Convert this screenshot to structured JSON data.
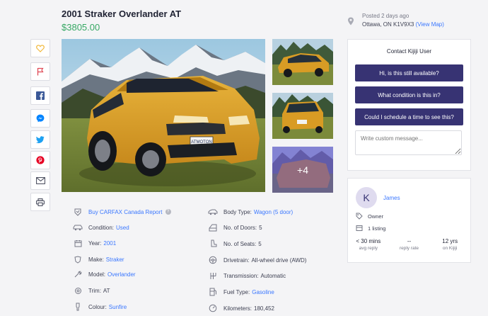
{
  "listing": {
    "title": "2001 Straker Overlander AT",
    "price": "$3805.00",
    "posted": "Posted 2 days ago",
    "location": "Ottawa, ON K1V9X3",
    "view_map": "(View Map)"
  },
  "share": [
    "favourite-icon",
    "report-flag-icon",
    "facebook-icon",
    "messenger-icon",
    "twitter-icon",
    "pinterest-icon",
    "email-icon",
    "print-icon"
  ],
  "gallery": {
    "more_count": "+4"
  },
  "contact": {
    "title": "Contact Kijiji User",
    "questions": [
      "Hi, is this still available?",
      "What condition is this in?",
      "Could I schedule a time to see this?"
    ],
    "custom_placeholder": "Write custom message..."
  },
  "seller": {
    "initial": "K",
    "name": "James",
    "role": "Owner",
    "listings": "1 listing",
    "stats": [
      {
        "value": "< 30 mins",
        "label": "avg reply"
      },
      {
        "value": "--",
        "label": "reply rate"
      },
      {
        "value": "12 yrs",
        "label": "on Kijiji"
      }
    ]
  },
  "attributes_left": {
    "carfax": "Buy CARFAX Canada Report",
    "condition_label": "Condition:",
    "condition_value": "Used",
    "year_label": "Year:",
    "year_value": "2001",
    "make_label": "Make:",
    "make_value": "Straker",
    "model_label": "Model:",
    "model_value": "Overlander",
    "trim_label": "Trim:",
    "trim_value": "AT",
    "colour_label": "Colour:",
    "colour_value": "Sunfire"
  },
  "attributes_right": {
    "body_label": "Body Type:",
    "body_value": "Wagon (5 door)",
    "doors_label": "No. of Doors:",
    "doors_value": "5",
    "seats_label": "No. of Seats:",
    "seats_value": "5",
    "drive_label": "Drivetrain:",
    "drive_value": "All-wheel drive (AWD)",
    "trans_label": "Transmission:",
    "trans_value": "Automatic",
    "fuel_label": "Fuel Type:",
    "fuel_value": "Gasoline",
    "km_label": "Kilometers:",
    "km_value": "180,452"
  },
  "colors": {
    "accent": "#373373",
    "link": "#3a77ff",
    "price": "#37a864"
  }
}
